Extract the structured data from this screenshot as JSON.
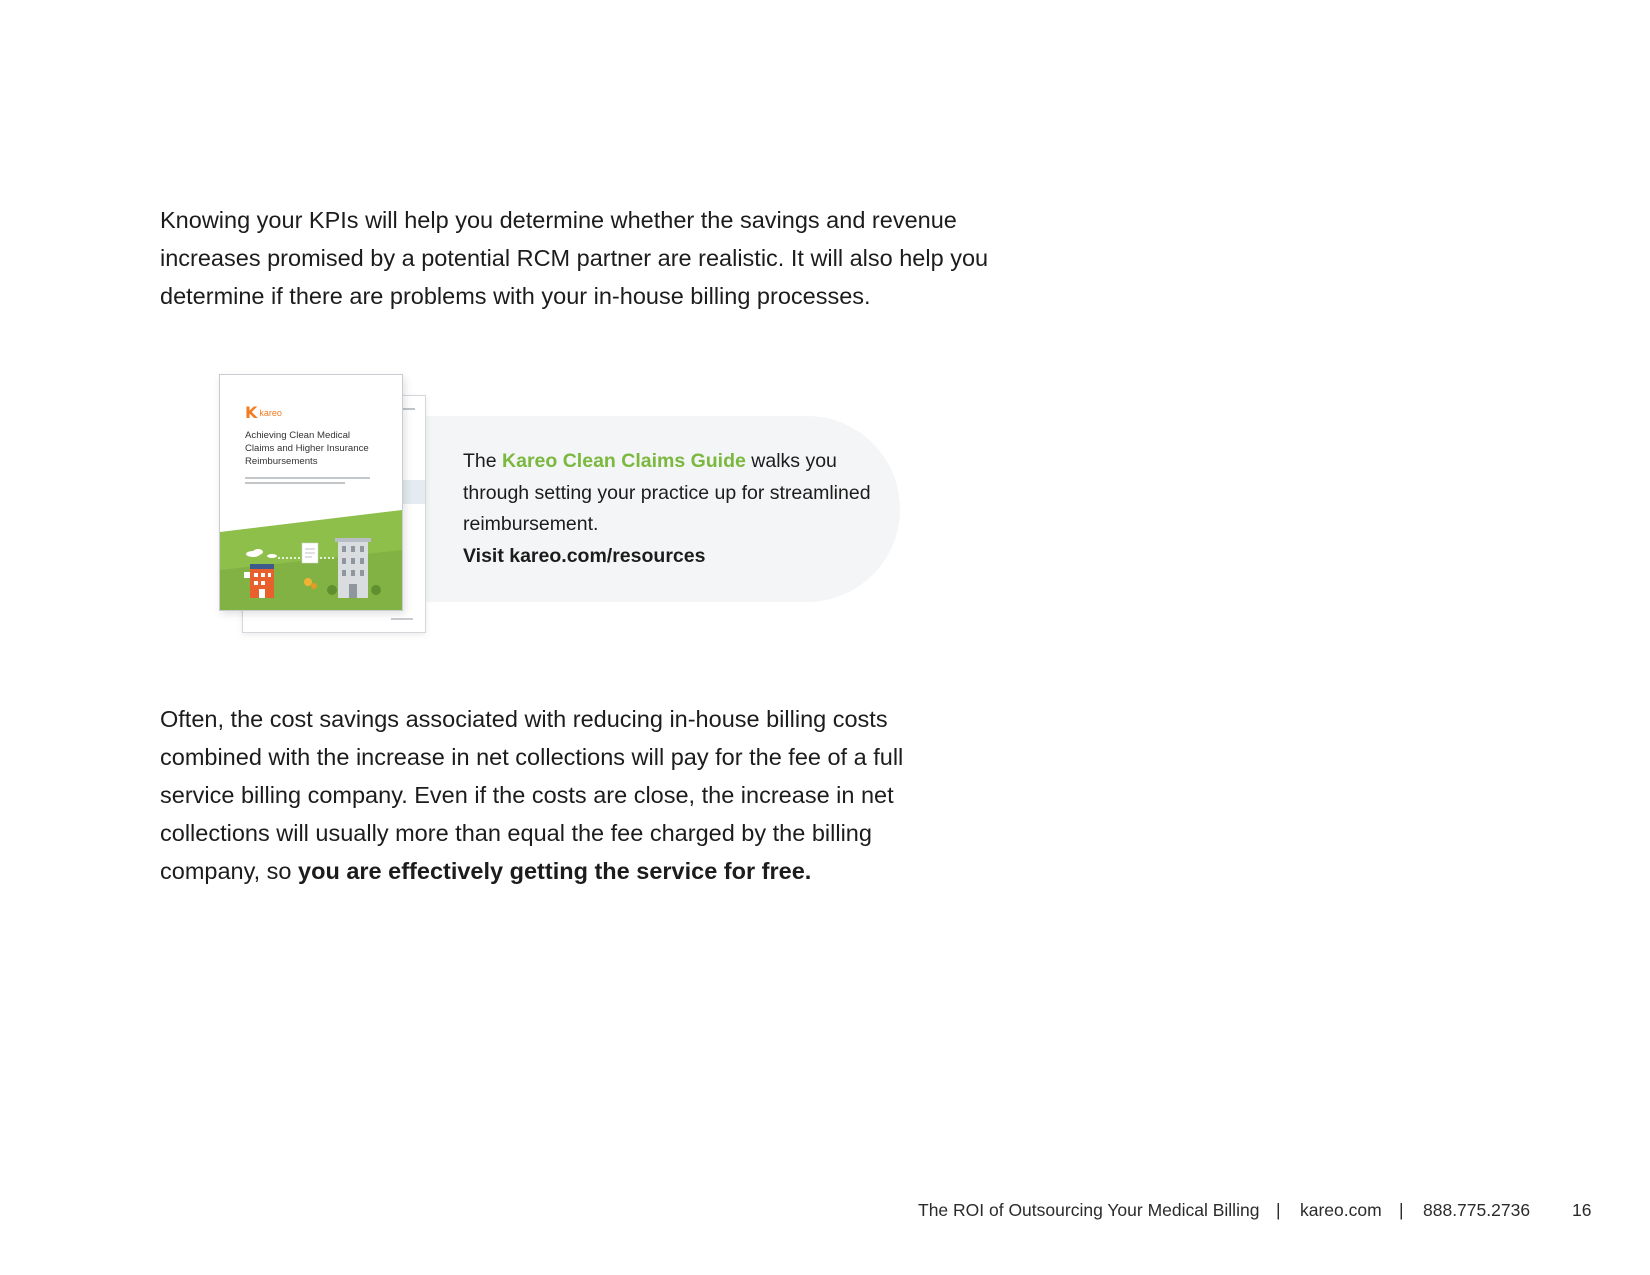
{
  "intro_paragraph": "Knowing your KPIs will help you determine whether the savings and revenue increases promised by a potential RCM partner are realistic. It will also help you determine if there are problems with your in-house billing processes.",
  "callout": {
    "lead": "The ",
    "guide_name": "Kareo Clean Claims Guide",
    "body": " walks you through setting your practice up for streamlined reimbursement.",
    "visit": "Visit kareo.com/resources"
  },
  "brochure": {
    "logo_text": "kareo",
    "title": "Achieving Clean Medical Claims and Higher Insurance Reimbursements"
  },
  "closing_paragraph": {
    "text": "Often, the cost savings associated with reducing in-house billing costs combined with the increase in net collections will pay for the fee of a full service billing company. Even if the costs are close, the increase in net collections will usually more than equal the fee charged by the billing company, so ",
    "bold": "you are effectively getting the service for free."
  },
  "footer": {
    "title": "The ROI of Outsourcing Your Medical Billing",
    "separator": "|",
    "website": "kareo.com",
    "phone": "888.775.2736",
    "page_number": "16"
  },
  "colors": {
    "accent_green": "#7ab83e",
    "brand_orange": "#f47b20",
    "callout_background": "#f3f5f6"
  }
}
